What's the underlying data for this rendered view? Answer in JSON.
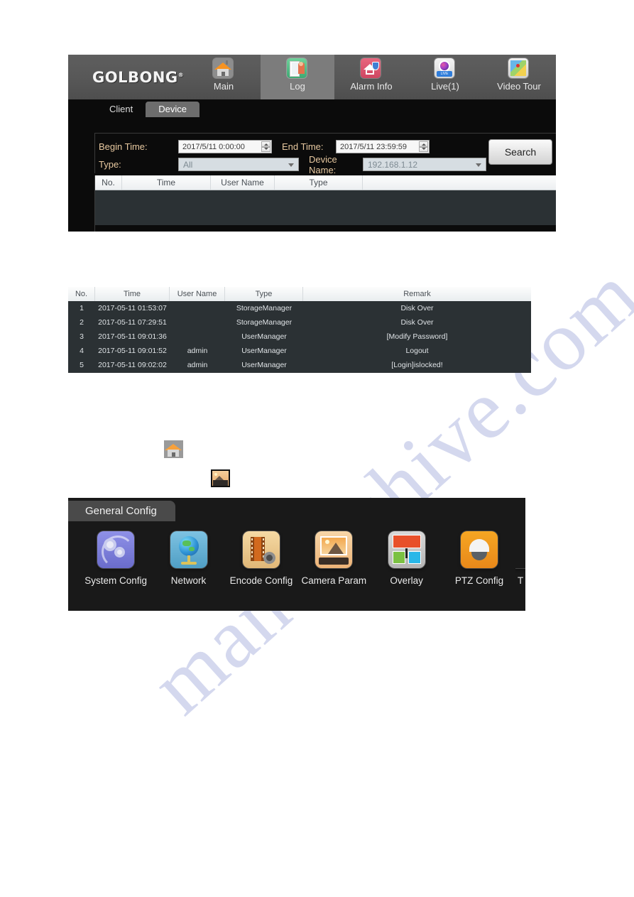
{
  "app": {
    "brand": "GOLBONG",
    "brand_sup": "®",
    "nav": [
      {
        "label": "Main",
        "icon": "house-icon",
        "active": false
      },
      {
        "label": "Log",
        "icon": "log-book-icon",
        "active": true
      },
      {
        "label": "Alarm Info",
        "icon": "alarm-shield-icon",
        "active": false
      },
      {
        "label": "Live(1)",
        "icon": "live-camera-icon",
        "active": false
      },
      {
        "label": "Video Tour",
        "icon": "map-tour-icon",
        "active": false
      }
    ]
  },
  "log_page": {
    "sub_tabs": [
      {
        "label": "Client",
        "active": false
      },
      {
        "label": "Device",
        "active": true
      }
    ],
    "form": {
      "begin_time_label": "Begin Time:",
      "begin_time_value": "2017/5/11 0:00:00",
      "end_time_label": "End Time:",
      "end_time_value": "2017/5/11 23:59:59",
      "type_label": "Type:",
      "type_value": "All",
      "device_name_label": "Device Name:",
      "device_name_value": "192.168.1.12",
      "search_button": "Search"
    },
    "empty_table_headers": [
      "No.",
      "Time",
      "User Name",
      "Type",
      ""
    ]
  },
  "results": {
    "headers": [
      "No.",
      "Time",
      "User Name",
      "Type",
      "Remark"
    ],
    "rows": [
      {
        "no": "1",
        "time": "2017-05-11 01:53:07",
        "user": "",
        "type": "StorageManager",
        "remark": "Disk Over"
      },
      {
        "no": "2",
        "time": "2017-05-11 07:29:51",
        "user": "",
        "type": "StorageManager",
        "remark": "Disk Over"
      },
      {
        "no": "3",
        "time": "2017-05-11 09:01:36",
        "user": "",
        "type": "UserManager",
        "remark": "[Modify Password]"
      },
      {
        "no": "4",
        "time": "2017-05-11 09:01:52",
        "user": "admin",
        "type": "UserManager",
        "remark": "Logout"
      },
      {
        "no": "5",
        "time": "2017-05-11 09:02:02",
        "user": "admin",
        "type": "UserManager",
        "remark": "[Login]islocked!"
      }
    ]
  },
  "standalone_icons": [
    {
      "name": "house-icon"
    },
    {
      "name": "camera-param-icon"
    }
  ],
  "config_panel": {
    "tab_label": "General Config",
    "items": [
      {
        "label": "System Config",
        "icon": "system-config-icon"
      },
      {
        "label": "Network",
        "icon": "network-globe-icon"
      },
      {
        "label": "Encode Config",
        "icon": "encode-film-icon"
      },
      {
        "label": "Camera Param",
        "icon": "camera-photo-icon"
      },
      {
        "label": "Overlay",
        "icon": "overlay-blocks-icon"
      },
      {
        "label": "PTZ Config",
        "icon": "ptz-dome-icon"
      },
      {
        "label": "T",
        "icon": "clipped-icon"
      }
    ]
  },
  "watermark": {
    "text": "manualshive.com"
  }
}
